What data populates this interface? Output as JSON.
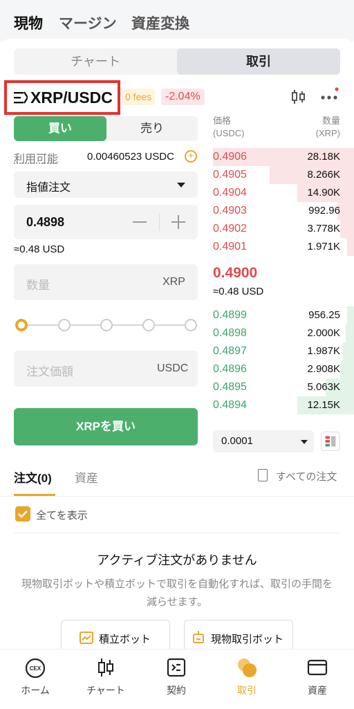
{
  "top_tabs": {
    "spot": "現物",
    "margin": "マージン",
    "convert": "資産変換"
  },
  "view_tabs": {
    "chart": "チャート",
    "trade": "取引"
  },
  "pair": {
    "name": "XRP/USDC",
    "fees": "0 fees",
    "change": "-2.04%"
  },
  "side": {
    "buy": "買い",
    "sell": "売り"
  },
  "available": {
    "label": "利用可能",
    "value": "0.00460523 USDC"
  },
  "order_type": "指値注文",
  "price": {
    "value": "0.4898",
    "approx": "≈0.48 USD"
  },
  "quantity": {
    "placeholder": "数量",
    "unit": "XRP"
  },
  "total": {
    "placeholder": "注文価額",
    "unit": "USDC"
  },
  "slider": {
    "percent": 0
  },
  "buy_button": "XRPを買い",
  "orderbook": {
    "price_header": "価格",
    "price_unit": "(USDC)",
    "qty_header": "数量",
    "qty_unit": "(XRP)",
    "asks": [
      {
        "price": "0.4906",
        "qty": "28.18K",
        "depth": 1.0
      },
      {
        "price": "0.4905",
        "qty": "8.266K",
        "depth": 0.6
      },
      {
        "price": "0.4904",
        "qty": "14.90K",
        "depth": 0.4
      },
      {
        "price": "0.4903",
        "qty": "992.96",
        "depth": 0.12
      },
      {
        "price": "0.4902",
        "qty": "3.778K",
        "depth": 0.1
      },
      {
        "price": "0.4901",
        "qty": "1.971K",
        "depth": 0.05
      }
    ],
    "last_price": "0.4900",
    "last_usd": "≈0.48 USD",
    "bids": [
      {
        "price": "0.4899",
        "qty": "956.25",
        "depth": 0.05
      },
      {
        "price": "0.4898",
        "qty": "2.000K",
        "depth": 0.06
      },
      {
        "price": "0.4897",
        "qty": "1.987K",
        "depth": 0.08
      },
      {
        "price": "0.4896",
        "qty": "2.908K",
        "depth": 0.1
      },
      {
        "price": "0.4895",
        "qty": "5.063K",
        "depth": 0.2
      },
      {
        "price": "0.4894",
        "qty": "12.15K",
        "depth": 0.4
      }
    ],
    "step": "0.0001"
  },
  "orders": {
    "tab_orders": "注文(0)",
    "tab_assets": "資産",
    "all_orders": "すべての注文",
    "show_all": "全てを表示",
    "empty_title": "アクティブ注文がありません",
    "empty_desc": "現物取引ボットや積立ボットで取引を自動化すれば、取引の手間を減らせます。",
    "bot_dca": "積立ボット",
    "bot_spot": "現物取引ボット"
  },
  "nav": {
    "home": "ホーム",
    "chart": "チャート",
    "contract": "契約",
    "trade": "取引",
    "assets": "資産"
  },
  "colors": {
    "buy": "#4caf6c",
    "sell": "#e04a4e",
    "accent": "#e8a72a"
  }
}
